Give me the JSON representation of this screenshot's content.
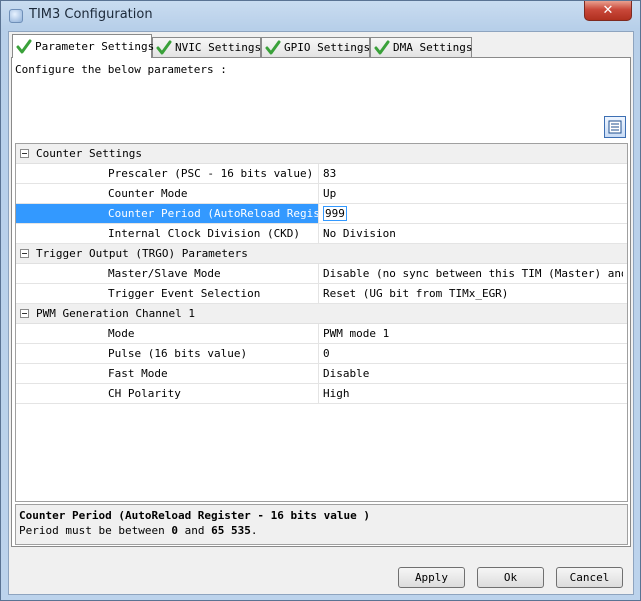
{
  "window": {
    "title": "TIM3 Configuration",
    "close_label": "✕"
  },
  "tabs": [
    {
      "label": "Parameter Settings",
      "active": true
    },
    {
      "label": "NVIC Settings",
      "active": false
    },
    {
      "label": "GPIO Settings",
      "active": false
    },
    {
      "label": "DMA Settings",
      "active": false
    }
  ],
  "intro_text": "Configure the below parameters :",
  "categories": [
    {
      "label": "Counter Settings",
      "params": [
        {
          "name": "Prescaler (PSC - 16 bits value)",
          "value": "83"
        },
        {
          "name": "Counter Mode",
          "value": "Up"
        },
        {
          "name": "Counter Period (AutoReload Regis...",
          "value": "999",
          "selected": true
        },
        {
          "name": "Internal Clock Division (CKD)",
          "value": "No Division"
        }
      ]
    },
    {
      "label": "Trigger Output (TRGO) Parameters",
      "params": [
        {
          "name": "Master/Slave Mode",
          "value": "Disable (no sync between this TIM (Master) and ..."
        },
        {
          "name": "Trigger Event Selection",
          "value": "Reset (UG bit from TIMx_EGR)"
        }
      ]
    },
    {
      "label": "PWM Generation Channel 1",
      "params": [
        {
          "name": "Mode",
          "value": "PWM mode 1"
        },
        {
          "name": "Pulse (16 bits value)",
          "value": "0"
        },
        {
          "name": "Fast Mode",
          "value": "Disable"
        },
        {
          "name": "CH Polarity",
          "value": "High"
        }
      ]
    }
  ],
  "description": {
    "title": "Counter Period (AutoReload Register - 16 bits value )",
    "text_prefix": "Period must be between ",
    "min": "0",
    "text_mid": " and ",
    "max": "65 535",
    "text_suffix": "."
  },
  "buttons": {
    "apply": "Apply",
    "ok": "Ok",
    "cancel": "Cancel"
  },
  "colors": {
    "selection": "#3399ff",
    "check_green": "#3aa13a"
  }
}
